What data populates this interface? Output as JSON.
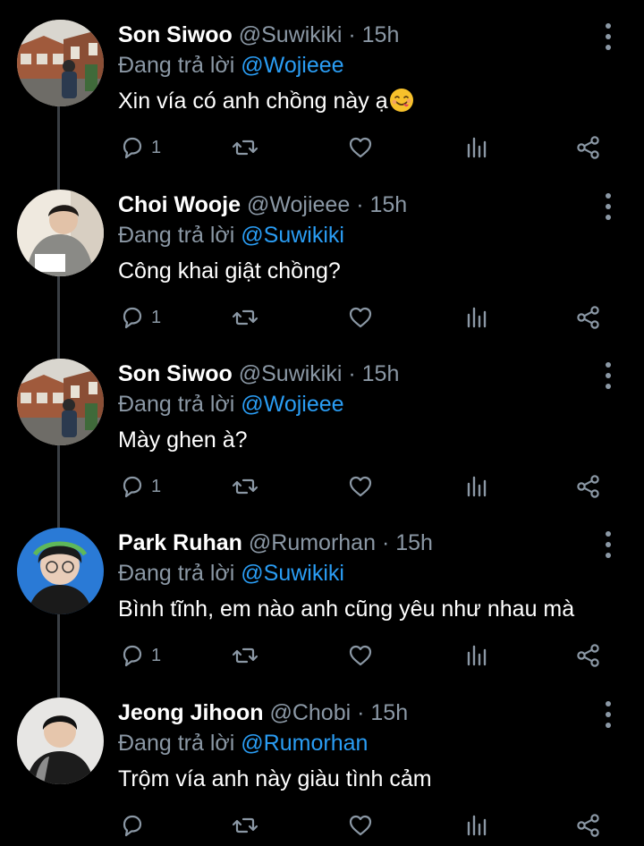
{
  "tweets": [
    {
      "name": "Son Siwoo",
      "handle": "@Suwikiki",
      "separator": "·",
      "time": "15h",
      "reply_prefix": "Đang trả lời",
      "reply_to": "@Wojieee",
      "text": "Xin vía có anh chồng này ạ",
      "has_emoji": true,
      "reply_count": "1",
      "avatar": "photo-house-street"
    },
    {
      "name": "Choi Wooje",
      "handle": "@Wojieee",
      "separator": "·",
      "time": "15h",
      "reply_prefix": "Đang trả lời",
      "reply_to": "@Suwikiki",
      "text": "Công khai giật chồng?",
      "has_emoji": false,
      "reply_count": "1",
      "avatar": "photo-person-grey-hoodie"
    },
    {
      "name": "Son Siwoo",
      "handle": "@Suwikiki",
      "separator": "·",
      "time": "15h",
      "reply_prefix": "Đang trả lời",
      "reply_to": "@Wojieee",
      "text": "Mày ghen à?",
      "has_emoji": false,
      "reply_count": "1",
      "avatar": "photo-house-street"
    },
    {
      "name": "Park Ruhan",
      "handle": "@Rumorhan",
      "separator": "·",
      "time": "15h",
      "reply_prefix": "Đang trả lời",
      "reply_to": "@Suwikiki",
      "text": "Bình tĩnh, em nào anh cũng yêu như nhau mà",
      "has_emoji": false,
      "reply_count": "1",
      "avatar": "photo-person-blue-bg"
    },
    {
      "name": "Jeong Jihoon",
      "handle": "@Chobi",
      "separator": "·",
      "time": "15h",
      "reply_prefix": "Đang trả lời",
      "reply_to": "@Rumorhan",
      "text": "Trộm vía anh này giàu tình cảm",
      "has_emoji": false,
      "reply_count": "",
      "avatar": "photo-person-dark-shirt"
    }
  ],
  "icons": {
    "reply": "reply-icon",
    "retweet": "retweet-icon",
    "like": "heart-icon",
    "views": "views-icon",
    "share": "share-icon",
    "more": "more-vertical-icon"
  },
  "colors": {
    "background": "#000000",
    "text": "#ffffff",
    "secondary": "#8b98a5",
    "link": "#2a9df4",
    "thread_line": "#3a3f44"
  }
}
